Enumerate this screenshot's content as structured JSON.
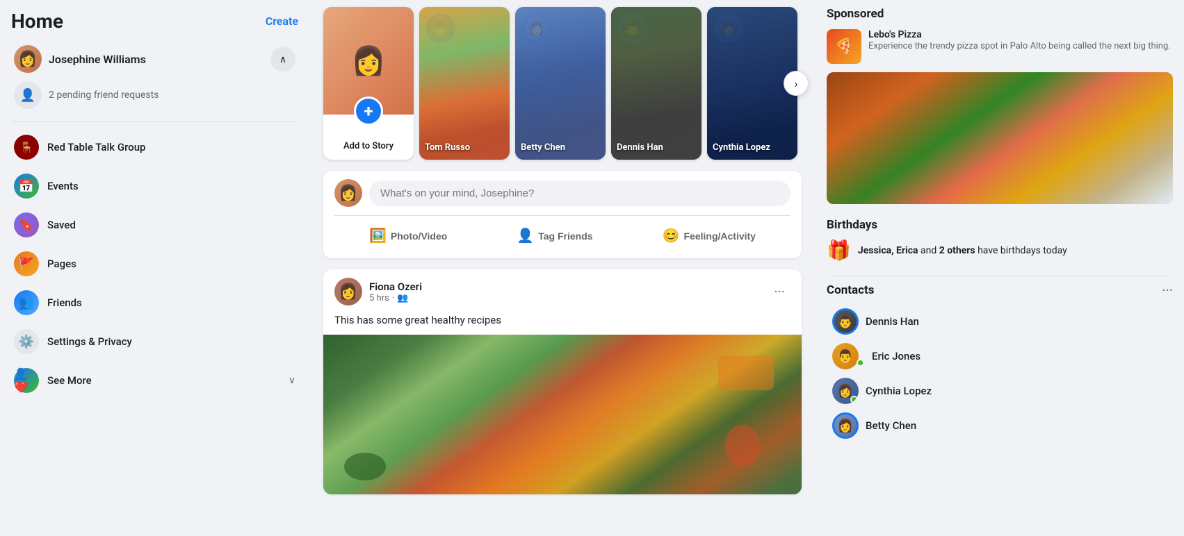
{
  "sidebar": {
    "title": "Home",
    "create_label": "Create",
    "user": {
      "name": "Josephine Williams",
      "pending_requests": "2 pending friend requests"
    },
    "items": [
      {
        "id": "red-table-talk",
        "label": "Red Table Talk Group",
        "icon": "🟥"
      },
      {
        "id": "events",
        "label": "Events",
        "icon": "📅"
      },
      {
        "id": "saved",
        "label": "Saved",
        "icon": "🔖"
      },
      {
        "id": "pages",
        "label": "Pages",
        "icon": "🚩"
      },
      {
        "id": "friends",
        "label": "Friends",
        "icon": "👥"
      },
      {
        "id": "settings",
        "label": "Settings & Privacy",
        "icon": "⚙️"
      },
      {
        "id": "see-more",
        "label": "See More",
        "icon": "🔗"
      }
    ]
  },
  "stories": {
    "add_label": "Add to Story",
    "next_button": "›",
    "items": [
      {
        "id": "add",
        "type": "add",
        "label": "Add to Story"
      },
      {
        "id": "tom-russo",
        "name": "Tom Russo"
      },
      {
        "id": "betty-chen",
        "name": "Betty Chen"
      },
      {
        "id": "dennis-han",
        "name": "Dennis Han"
      },
      {
        "id": "cynthia-lopez",
        "name": "Cynthia Lopez"
      }
    ]
  },
  "post_box": {
    "placeholder": "What's on your mind, Josephine?",
    "actions": [
      {
        "id": "photo-video",
        "label": "Photo/Video",
        "icon": "🖼️"
      },
      {
        "id": "tag-friends",
        "label": "Tag Friends",
        "icon": "👤"
      },
      {
        "id": "feeling",
        "label": "Feeling/Activity",
        "icon": "😊"
      }
    ]
  },
  "feed": {
    "posts": [
      {
        "id": "fiona-post",
        "author": "Fiona Ozeri",
        "time": "5 hrs",
        "privacy": "friends",
        "text": "This has some great healthy recipes",
        "has_image": true
      }
    ]
  },
  "right_sidebar": {
    "sponsored": {
      "title": "Sponsored",
      "name": "Lebo's Pizza",
      "description": "Experience the trendy pizza spot in Palo Alto being called the next big thing.",
      "icon": "🍕"
    },
    "birthdays": {
      "title": "Birthdays",
      "text_prefix": "Jessica, Erica",
      "text_bold": "Jessica, Erica",
      "and_others": " and ",
      "others": "2 others",
      "text_suffix": " have birthdays today",
      "icon": "🎁"
    },
    "contacts": {
      "title": "Contacts",
      "more": "···",
      "items": [
        {
          "id": "dennis-han",
          "name": "Dennis Han",
          "online": false,
          "ring": true
        },
        {
          "id": "eric-jones",
          "name": "Eric Jones",
          "online": true,
          "ring": false
        },
        {
          "id": "cynthia-lopez",
          "name": "Cynthia Lopez",
          "online": true,
          "ring": false
        },
        {
          "id": "betty-chen",
          "name": "Betty Chen",
          "online": false,
          "ring": true
        }
      ]
    }
  }
}
